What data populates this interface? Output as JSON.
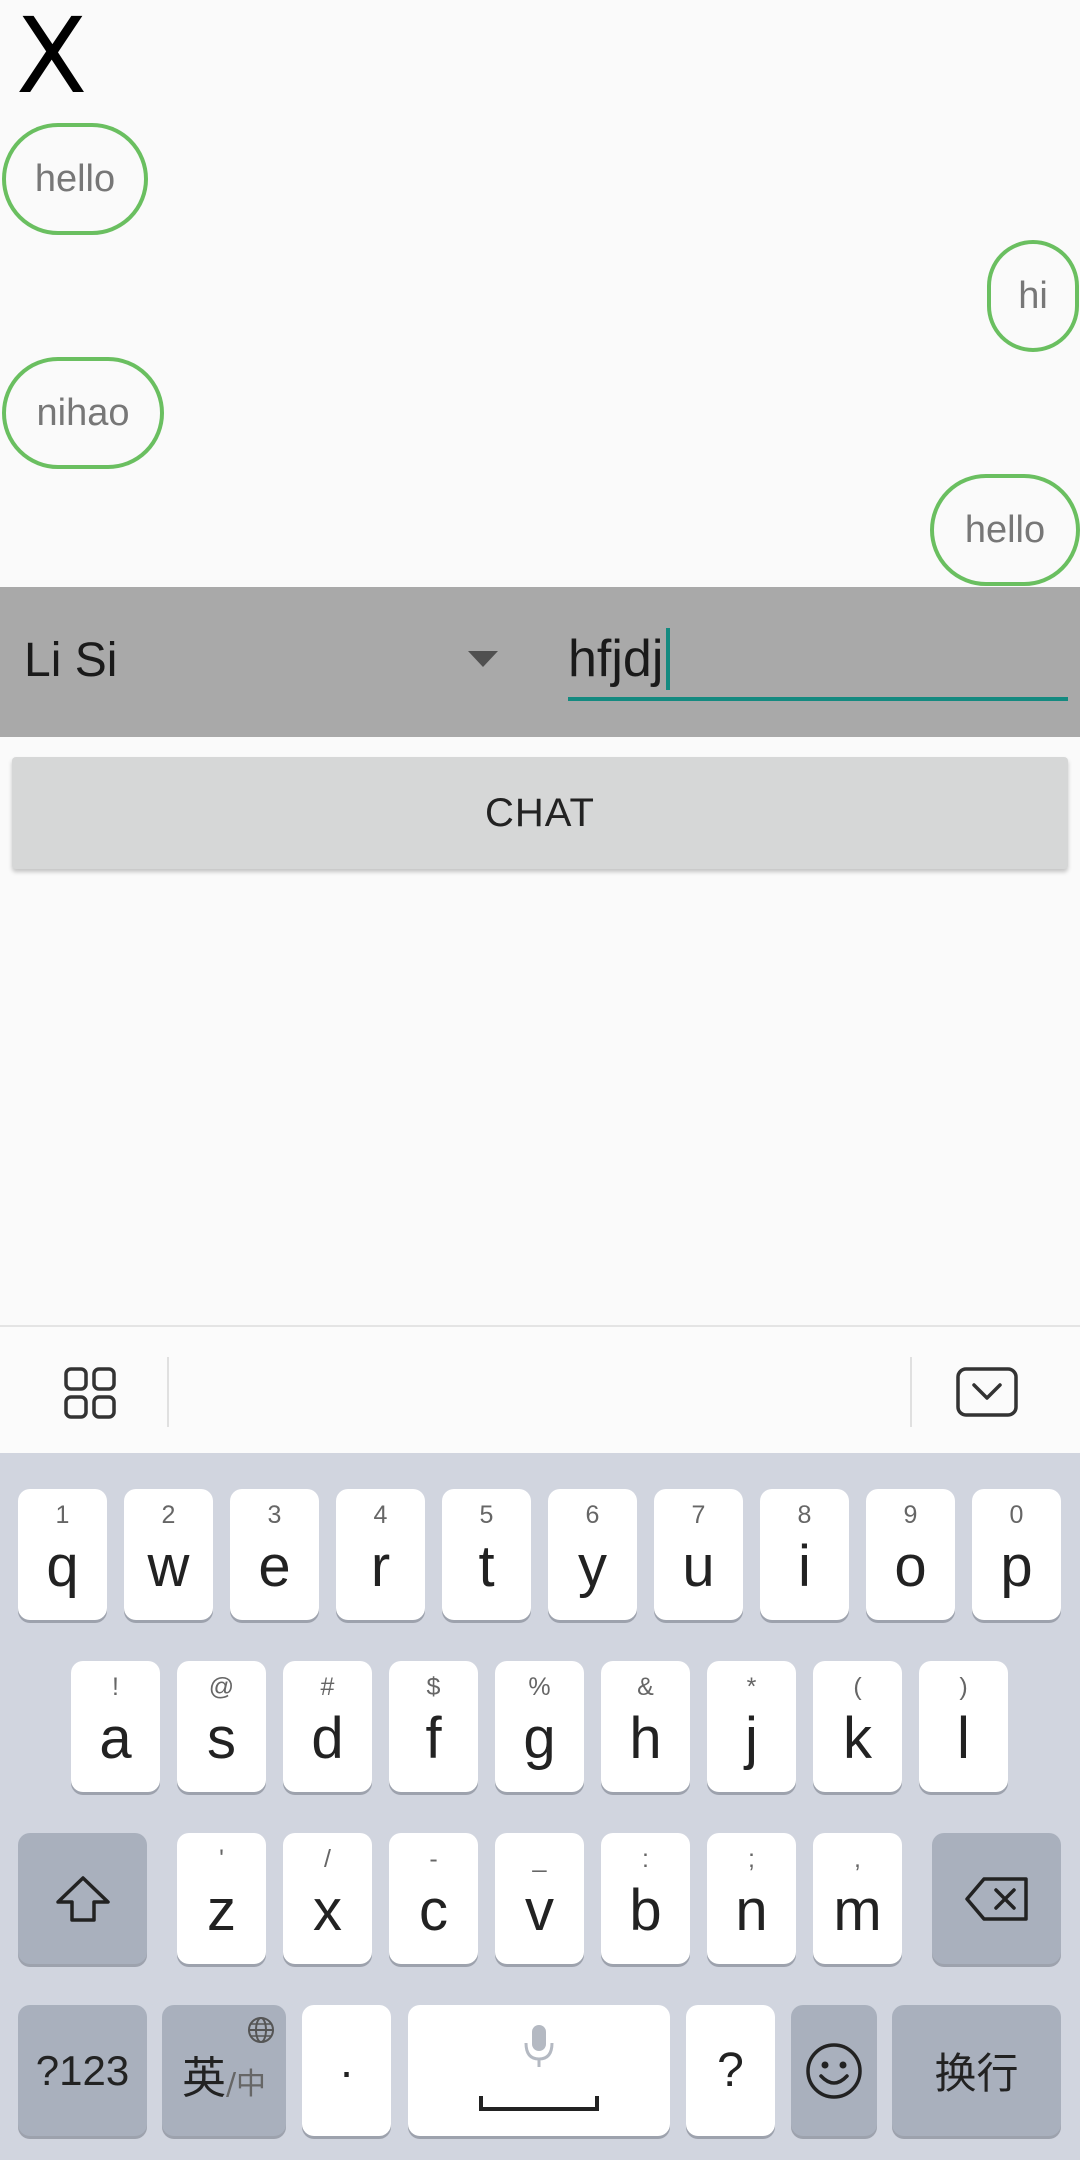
{
  "close_label": "X",
  "messages": [
    {
      "text": "hello",
      "side": "left"
    },
    {
      "text": "hi",
      "side": "right"
    },
    {
      "text": "nihao",
      "side": "left"
    },
    {
      "text": "hello",
      "side": "right"
    }
  ],
  "recipient": "Li Si",
  "message_input": "hfjdj",
  "chat_button": "CHAT",
  "keyboard": {
    "row1": [
      {
        "hint": "1",
        "key": "q"
      },
      {
        "hint": "2",
        "key": "w"
      },
      {
        "hint": "3",
        "key": "e"
      },
      {
        "hint": "4",
        "key": "r"
      },
      {
        "hint": "5",
        "key": "t"
      },
      {
        "hint": "6",
        "key": "y"
      },
      {
        "hint": "7",
        "key": "u"
      },
      {
        "hint": "8",
        "key": "i"
      },
      {
        "hint": "9",
        "key": "o"
      },
      {
        "hint": "0",
        "key": "p"
      }
    ],
    "row2": [
      {
        "hint": "!",
        "key": "a"
      },
      {
        "hint": "@",
        "key": "s"
      },
      {
        "hint": "#",
        "key": "d"
      },
      {
        "hint": "$",
        "key": "f"
      },
      {
        "hint": "%",
        "key": "g"
      },
      {
        "hint": "&",
        "key": "h"
      },
      {
        "hint": "*",
        "key": "j"
      },
      {
        "hint": "(",
        "key": "k"
      },
      {
        "hint": ")",
        "key": "l"
      }
    ],
    "row3": [
      {
        "hint": "'",
        "key": "z"
      },
      {
        "hint": "/",
        "key": "x"
      },
      {
        "hint": "-",
        "key": "c"
      },
      {
        "hint": "_",
        "key": "v"
      },
      {
        "hint": ":",
        "key": "b"
      },
      {
        "hint": ";",
        "key": "n"
      },
      {
        "hint": ",",
        "key": "m"
      }
    ],
    "symbols_key": "?123",
    "lang_key_main": "英",
    "lang_key_sub": "/中",
    "dot_key": "·",
    "question_key": "?",
    "enter_key": "换行"
  },
  "colors": {
    "bubble_border": "#6abf60",
    "accent": "#148a80",
    "input_bar": "#a9a9a9"
  }
}
